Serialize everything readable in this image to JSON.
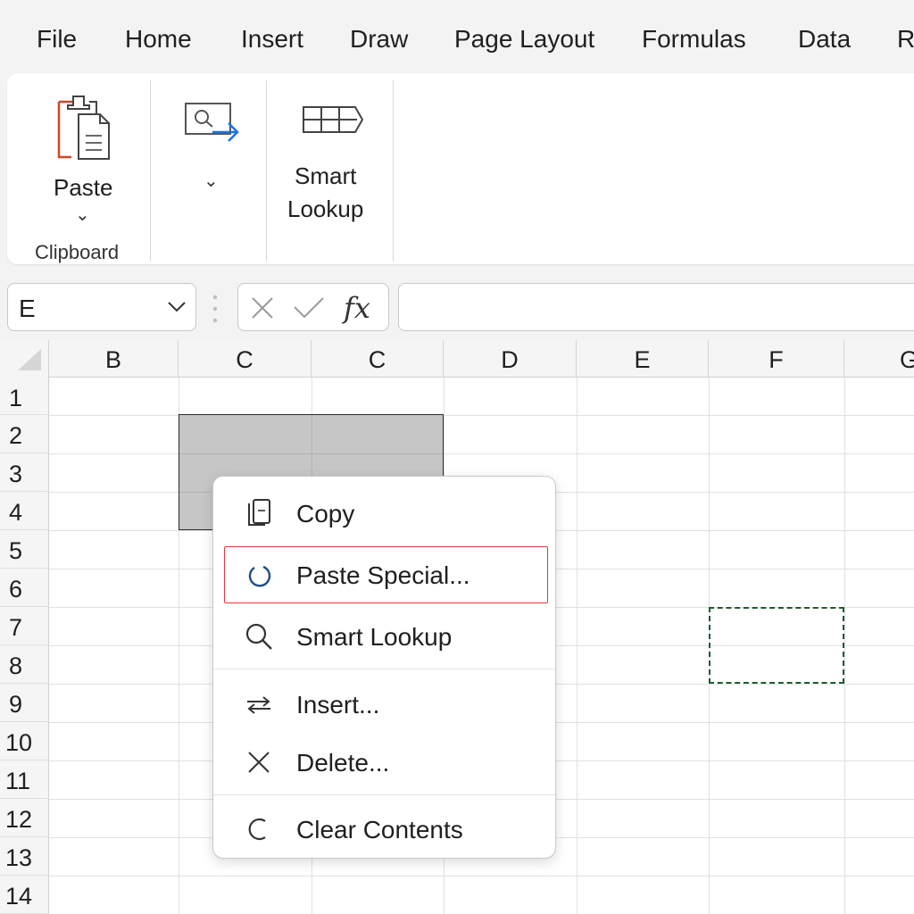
{
  "menubar": {
    "items": [
      "File",
      "Home",
      "Insert",
      "Draw",
      "Page Layout",
      "Formulas",
      "Data",
      "R"
    ]
  },
  "ribbon": {
    "paste_label": "Paste",
    "clipboard_group_label": "Clipboard",
    "dropdown_chevron": "⌄",
    "smart_lookup_label_line1": "Smart",
    "smart_lookup_label_line2": "Lookup",
    "icons": [
      "paste-icon",
      "find-select-icon",
      "smart-lookup-icon"
    ]
  },
  "formula_bar": {
    "name_box_value": "E",
    "fx_label": "fx",
    "formula_value": ""
  },
  "grid": {
    "columns": [
      "B",
      "C",
      "C",
      "D",
      "E",
      "F",
      "G"
    ],
    "rows": [
      "1",
      "2",
      "3",
      "4",
      "5",
      "6",
      "7",
      "8",
      "9",
      "10",
      "11",
      "12",
      "13",
      "14"
    ]
  },
  "context_menu": {
    "items": [
      {
        "label": "Copy",
        "icon": "copy-icon"
      },
      {
        "label": "Paste Special...",
        "icon": "paste-special-icon",
        "highlighted": true
      },
      {
        "label": "Smart Lookup",
        "icon": "search-icon"
      },
      {
        "label": "Insert...",
        "icon": "insert-icon"
      },
      {
        "label": "Delete...",
        "icon": "delete-icon"
      },
      {
        "label": "Clear Contents",
        "icon": "clear-contents-icon"
      }
    ],
    "highlight_color": "#e03a3a"
  },
  "colors": {
    "accent_orange": "#d24726",
    "accent_blue": "#1a73e8",
    "marquee_green": "#1e5b32",
    "selection_gray": "#c6c6c6"
  }
}
